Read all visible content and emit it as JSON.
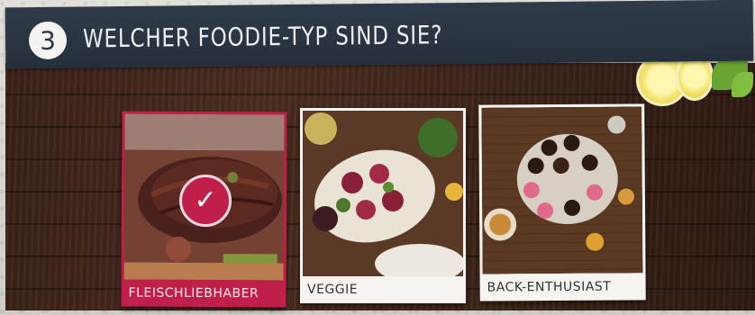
{
  "header": {
    "step_number": "3",
    "title": "WELCHER FOODIE-TYP SIND SIE?"
  },
  "options": [
    {
      "label": "FLEISCHLIEBHABER",
      "selected": true
    },
    {
      "label": "VEGGIE",
      "selected": false
    },
    {
      "label": "BACK-ENTHUSIAST",
      "selected": false
    }
  ],
  "colors": {
    "header_bg": "#2a3542",
    "accent": "#c01f4a",
    "wood": "#4a2c1f",
    "card_bg": "#f5f4f0"
  },
  "icons": [
    "checkmark-icon"
  ]
}
